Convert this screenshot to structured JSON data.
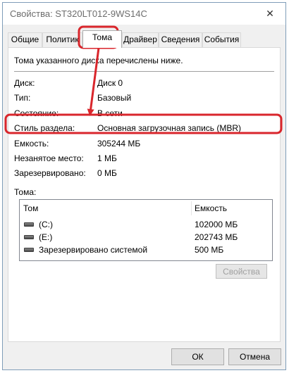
{
  "window": {
    "title": "Свойства: ST320LT012-9WS14C",
    "close_label": "✕"
  },
  "tabs": [
    {
      "label": "Общие"
    },
    {
      "label": "Политик"
    },
    {
      "label": "Тома",
      "active": true
    },
    {
      "label": "Драйвер"
    },
    {
      "label": "Сведения"
    },
    {
      "label": "События"
    }
  ],
  "panel": {
    "intro": "Тома указанного диска перечислены ниже.",
    "properties": [
      {
        "label": "Диск:",
        "value": "Диск 0"
      },
      {
        "label": "Тип:",
        "value": "Базовый"
      },
      {
        "label": "Состояние:",
        "value": "В сети"
      },
      {
        "label": "Стиль раздела:",
        "value": "Основная загрузочная запись (MBR)"
      },
      {
        "label": "Емкость:",
        "value": "305244 МБ"
      },
      {
        "label": "Незанятое место:",
        "value": "1 МБ"
      },
      {
        "label": "Зарезервировано:",
        "value": "0 МБ"
      }
    ],
    "volumes_label": "Тома:",
    "volumes_table": {
      "columns": [
        "Том",
        "Емкость"
      ],
      "rows": [
        {
          "volume": "(C:)",
          "capacity": "102000 МБ"
        },
        {
          "volume": "(E:)",
          "capacity": "202743 МБ"
        },
        {
          "volume": "Зарезервировано системой",
          "capacity": "500 МБ"
        }
      ]
    },
    "properties_button": "Свойства"
  },
  "footer": {
    "ok": "ОК",
    "cancel": "Отмена"
  },
  "annotation": {
    "color": "#d9262c"
  }
}
